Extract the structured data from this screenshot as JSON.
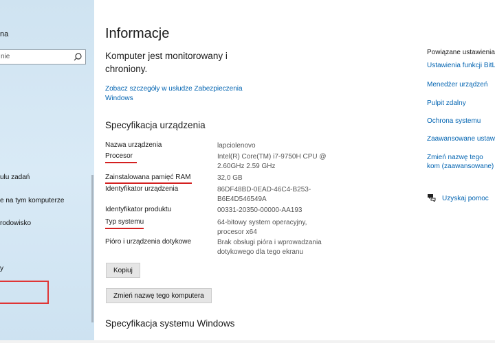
{
  "sidebar": {
    "title_fragment": "na",
    "search_placeholder": "nie",
    "items": [
      {
        "label": "ulu zadań"
      },
      {
        "label": "e na tym komputerze"
      },
      {
        "label": "rodowisko"
      },
      {
        "label": "y"
      }
    ]
  },
  "main": {
    "title": "Informacje",
    "protection_text": "Komputer jest monitorowany i chroniony.",
    "security_link": "Zobacz szczegóły w usłudze Zabezpieczenia Windows",
    "device_spec_title": "Specyfikacja urządzenia",
    "specs": [
      {
        "label": "Nazwa urządzenia",
        "value": "lapciolenovo"
      },
      {
        "label": "Procesor",
        "value": "Intel(R) Core(TM) i7-9750H CPU @ 2.60GHz   2.59 GHz"
      },
      {
        "label": "Zainstalowana pamięć RAM",
        "value": "32,0 GB"
      },
      {
        "label": "Identyfikator urządzenia",
        "value": "86DF48BD-0EAD-46C4-B253-B6E4D546549A"
      },
      {
        "label": "Identyfikator produktu",
        "value": "00331-20350-00000-AA193"
      },
      {
        "label": "Typ systemu",
        "value": "64-bitowy system operacyjny, procesor x64"
      },
      {
        "label": "Pióro i urządzenia dotykowe",
        "value": "Brak obsługi pióra i wprowadzania dotykowego dla tego ekranu"
      }
    ],
    "copy_button": "Kopiuj",
    "rename_button": "Zmień nazwę tego komputera",
    "windows_spec_title": "Specyfikacja systemu Windows"
  },
  "related": {
    "title": "Powiązane ustawienia",
    "links": [
      "Ustawienia funkcji BitLo",
      "Menedżer urządzeń",
      "Pulpit zdalny",
      "Ochrona systemu",
      "Zaawansowane ustawie",
      "Zmień nazwę tego kom (zaawansowane)"
    ],
    "help": "Uzyskaj pomoc"
  },
  "colors": {
    "accent_link": "#0063b1",
    "annotation_red": "#d42020",
    "sidebar_bg": "#d9eaf6"
  }
}
